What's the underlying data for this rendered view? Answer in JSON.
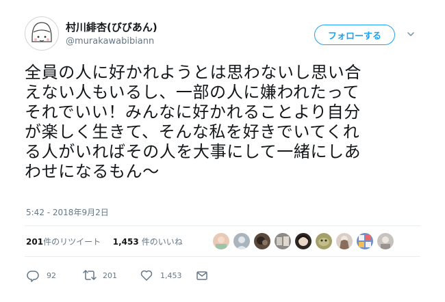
{
  "user": {
    "display_name": "村川緋杏(びびあん)",
    "handle": "@murakawabibiann"
  },
  "header": {
    "follow_label": "フォローする"
  },
  "tweet": {
    "lines": [
      "全員の人に好かれようとは思わないし思い合",
      "えない人もいるし、一部の人に嫌われたって",
      "それでいい！みんなに好かれることより自分",
      "が楽しく生きて、そんな私を好きでいてくれ",
      "る人がいればその人を大事にして一緒にしあ",
      "わせになるもん〜"
    ],
    "timestamp": "5:42 - 2018年9月2日"
  },
  "stats": {
    "retweets": "201",
    "retweets_label": "件のリツイート",
    "likes": "1,453",
    "likes_label": "件のいいね"
  },
  "likers": [
    {
      "icon": "liker-avatar-1",
      "color": "#e8c9b5"
    },
    {
      "icon": "liker-avatar-2",
      "color": "#aab4bd"
    },
    {
      "icon": "liker-avatar-3",
      "color": "#5b4a3c"
    },
    {
      "icon": "liker-avatar-4",
      "color": "#8c8a86"
    },
    {
      "icon": "liker-avatar-5",
      "color": "#2e2622"
    },
    {
      "icon": "liker-avatar-6",
      "color": "#a5a06a"
    },
    {
      "icon": "liker-avatar-7",
      "color": "#d9cfc6"
    },
    {
      "icon": "liker-avatar-8",
      "color": "#6e8fc9"
    },
    {
      "icon": "liker-avatar-9",
      "color": "#c7c2bd"
    }
  ],
  "actions": {
    "reply_count": "92",
    "retweet_count": "201",
    "like_count": "1,453"
  },
  "colors": {
    "accent": "#1da1f2",
    "text": "#14171a",
    "secondary_text": "#657786",
    "divider": "#e6ecf0"
  }
}
